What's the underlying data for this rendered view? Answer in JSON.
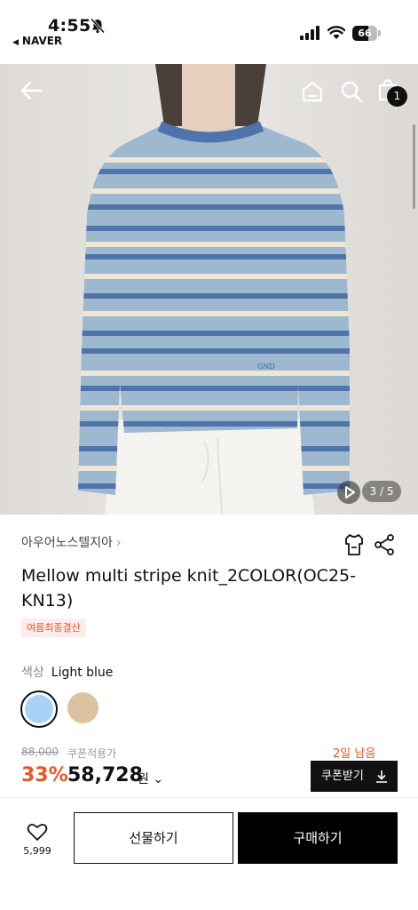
{
  "status_bar": {
    "time": "4:55",
    "back_app": "NAVER",
    "battery": 66,
    "battery_label": "66"
  },
  "hero": {
    "page_indicator": "3 / 5",
    "cart_count": "1"
  },
  "product": {
    "brand": "아우어노스텔지아",
    "title": "Mellow multi stripe knit_2COLOR(OC25-KN13)",
    "promo_tag": "여름최종결산",
    "color_key": "색상",
    "color_value": "Light blue",
    "swatches": [
      {
        "name": "Light blue",
        "color": "#a9d1f5",
        "selected": true
      },
      {
        "name": "Beige",
        "color": "#dcc2a0",
        "selected": false
      }
    ]
  },
  "price": {
    "original": "88,000",
    "coupon_note": "쿠폰적용가",
    "days_left": "2일 남음",
    "discount": "33%",
    "sale": "58,728",
    "currency": "원",
    "coupon_button": "쿠폰받기"
  },
  "bottom_bar": {
    "like_count": "5,999",
    "gift_label": "선물하기",
    "buy_label": "구매하기"
  },
  "colors": {
    "accent": "#e8572a",
    "primary": "#111111",
    "sweater_base": "#9db8cf",
    "stripe_blue": "#4e74ab",
    "stripe_cream": "#efe6d3"
  }
}
